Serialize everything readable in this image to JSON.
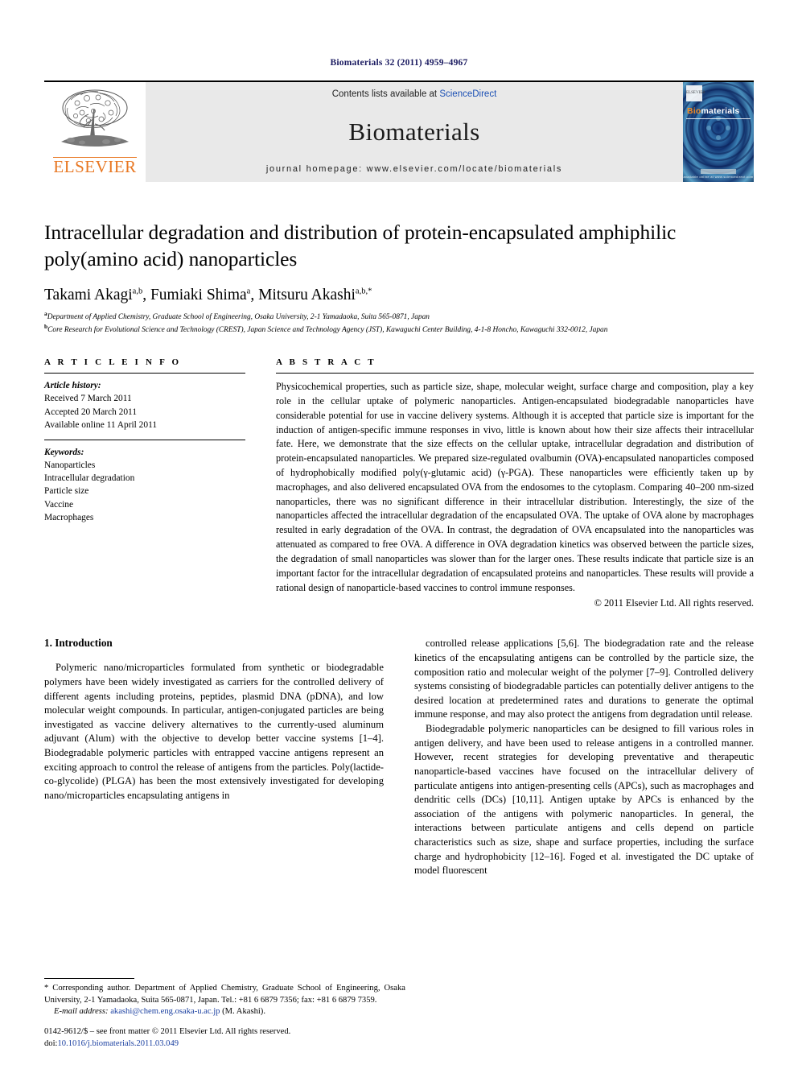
{
  "running_head": "Biomaterials 32 (2011) 4959–4967",
  "masthead": {
    "publisher_name": "ELSEVIER",
    "contents_prefix": "Contents lists available at ",
    "contents_link": "ScienceDirect",
    "journal_name": "Biomaterials",
    "homepage_line": "journal homepage: www.elsevier.com/locate/biomaterials",
    "cover": {
      "title_part1": "Bio",
      "title_part2": "materials",
      "publisher_mark": "ELSEVIER",
      "footer_text": "available online at www.sciencedirect.com"
    }
  },
  "article": {
    "title": "Intracellular degradation and distribution of protein-encapsulated amphiphilic poly(amino acid) nanoparticles",
    "authors": [
      {
        "name": "Takami Akagi",
        "marks": "a,b"
      },
      {
        "name": "Fumiaki Shima",
        "marks": "a"
      },
      {
        "name": "Mitsuru Akashi",
        "marks": "a,b,*"
      }
    ],
    "affiliations": [
      {
        "mark": "a",
        "text": "Department of Applied Chemistry, Graduate School of Engineering, Osaka University, 2-1 Yamadaoka, Suita 565-0871, Japan"
      },
      {
        "mark": "b",
        "text": "Core Research for Evolutional Science and Technology (CREST), Japan Science and Technology Agency (JST), Kawaguchi Center Building, 4-1-8 Honcho, Kawaguchi 332-0012, Japan"
      }
    ]
  },
  "article_info": {
    "heading": "A R T I C L E  I N F O",
    "history_label": "Article history:",
    "history": [
      "Received 7 March 2011",
      "Accepted 20 March 2011",
      "Available online 11 April 2011"
    ],
    "keywords_label": "Keywords:",
    "keywords": [
      "Nanoparticles",
      "Intracellular degradation",
      "Particle size",
      "Vaccine",
      "Macrophages"
    ]
  },
  "abstract": {
    "heading": "A B S T R A C T",
    "text": "Physicochemical properties, such as particle size, shape, molecular weight, surface charge and composition, play a key role in the cellular uptake of polymeric nanoparticles. Antigen-encapsulated biodegradable nanoparticles have considerable potential for use in vaccine delivery systems. Although it is accepted that particle size is important for the induction of antigen-specific immune responses in vivo, little is known about how their size affects their intracellular fate. Here, we demonstrate that the size effects on the cellular uptake, intracellular degradation and distribution of protein-encapsulated nanoparticles. We prepared size-regulated ovalbumin (OVA)-encapsulated nanoparticles composed of hydrophobically modified poly(γ-glutamic acid) (γ-PGA). These nanoparticles were efficiently taken up by macrophages, and also delivered encapsulated OVA from the endosomes to the cytoplasm. Comparing 40–200 nm-sized nanoparticles, there was no significant difference in their intracellular distribution. Interestingly, the size of the nanoparticles affected the intracellular degradation of the encapsulated OVA. The uptake of OVA alone by macrophages resulted in early degradation of the OVA. In contrast, the degradation of OVA encapsulated into the nanoparticles was attenuated as compared to free OVA. A difference in OVA degradation kinetics was observed between the particle sizes, the degradation of small nanoparticles was slower than for the larger ones. These results indicate that particle size is an important factor for the intracellular degradation of encapsulated proteins and nanoparticles. These results will provide a rational design of nanoparticle-based vaccines to control immune responses.",
    "copyright": "© 2011 Elsevier Ltd. All rights reserved."
  },
  "introduction": {
    "heading": "1.  Introduction",
    "left_paragraphs": [
      "Polymeric nano/microparticles formulated from synthetic or biodegradable polymers have been widely investigated as carriers for the controlled delivery of different agents including proteins, peptides, plasmid DNA (pDNA), and low molecular weight compounds. In particular, antigen-conjugated particles are being investigated as vaccine delivery alternatives to the currently-used aluminum adjuvant (Alum) with the objective to develop better vaccine systems [1–4]. Biodegradable polymeric particles with entrapped vaccine antigens represent an exciting approach to control the release of antigens from the particles. Poly(lactide-co-glycolide) (PLGA) has been the most extensively investigated for developing nano/microparticles encapsulating antigens in"
    ],
    "right_paragraphs": [
      "controlled release applications [5,6]. The biodegradation rate and the release kinetics of the encapsulating antigens can be controlled by the particle size, the composition ratio and molecular weight of the polymer [7–9]. Controlled delivery systems consisting of biodegradable particles can potentially deliver antigens to the desired location at predetermined rates and durations to generate the optimal immune response, and may also protect the antigens from degradation until release.",
      "Biodegradable polymeric nanoparticles can be designed to fill various roles in antigen delivery, and have been used to release antigens in a controlled manner. However, recent strategies for developing preventative and therapeutic nanoparticle-based vaccines have focused on the intracellular delivery of particulate antigens into antigen-presenting cells (APCs), such as macrophages and dendritic cells (DCs) [10,11]. Antigen uptake by APCs is enhanced by the association of the antigens with polymeric nanoparticles. In general, the interactions between particulate antigens and cells depend on particle characteristics such as size, shape and surface properties, including the surface charge and hydrophobicity [12–16]. Foged et al. investigated the DC uptake of model fluorescent"
    ]
  },
  "footnotes": {
    "corresponding": "* Corresponding author. Department of Applied Chemistry, Graduate School of Engineering, Osaka University, 2-1 Yamadaoka, Suita 565-0871, Japan. Tel.: +81 6 6879 7356; fax: +81 6 6879 7359.",
    "email_label": "E-mail address:",
    "email": "akashi@chem.eng.osaka-u.ac.jp",
    "email_suffix": "(M. Akashi)."
  },
  "imprint": {
    "issn_line": "0142-9612/$ – see front matter © 2011 Elsevier Ltd. All rights reserved.",
    "doi_label": "doi:",
    "doi": "10.1016/j.biomaterials.2011.03.049"
  },
  "colors": {
    "running_head": "#1a1a60",
    "elsevier_orange": "#E87722",
    "link_blue": "#1a3fa0",
    "band_gray": "#e9e9e9"
  }
}
